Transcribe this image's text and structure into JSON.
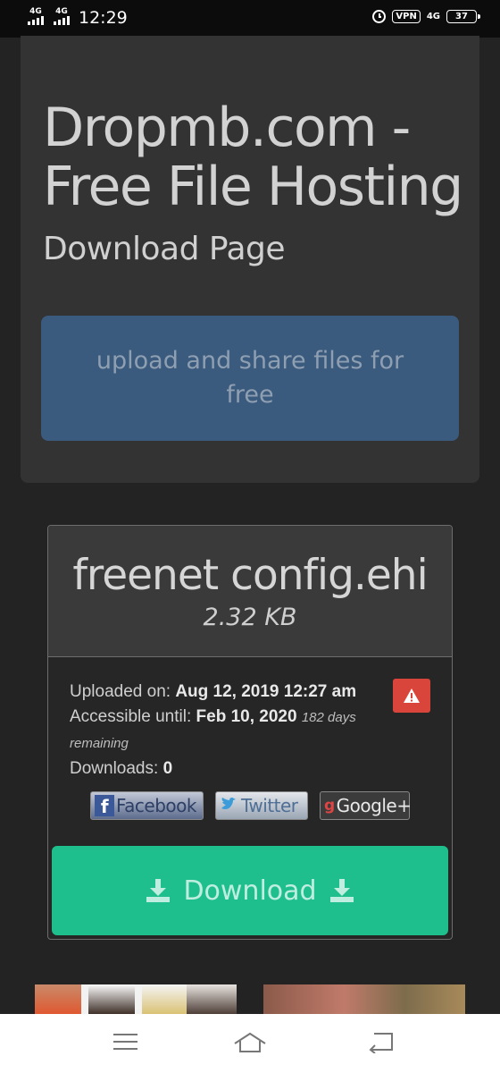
{
  "status_bar": {
    "sim1": "4G",
    "sim2": "4G",
    "time": "12:29",
    "vpn": "VPN",
    "network": "4G",
    "battery": "37"
  },
  "page": {
    "title": "Dropmb.com - Free File Hosting",
    "subtitle": "Download Page",
    "tagline": "upload and share files for free"
  },
  "file": {
    "name": "freenet config.ehi",
    "size": "2.32 KB",
    "uploaded_label": "Uploaded on:",
    "uploaded_value": "Aug 12, 2019 12:27 am",
    "accessible_label": "Accessible until:",
    "accessible_value": "Feb 10, 2020",
    "remaining": "182 days remaining",
    "downloads_label": "Downloads:",
    "downloads_value": "0"
  },
  "share": {
    "facebook": "Facebook",
    "twitter": "Twitter",
    "google": "Google+"
  },
  "actions": {
    "download_label": "Download",
    "report_icon": "warning-icon"
  },
  "colors": {
    "background": "#232323",
    "panel": "#333333",
    "tagline_button": "#3a5a7e",
    "download_button": "#1fbe8d",
    "report_button": "#d9453a"
  },
  "nav_bar": {
    "icons": [
      "menu-icon",
      "home-icon",
      "back-icon"
    ]
  }
}
